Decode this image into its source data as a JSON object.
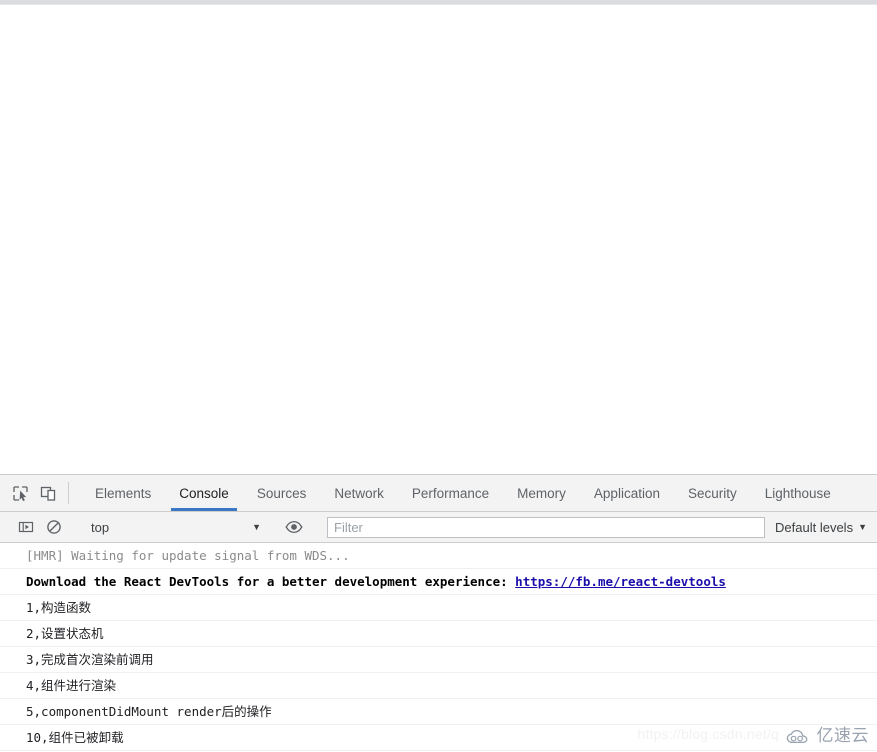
{
  "page": {
    "blank_content": ""
  },
  "devtools": {
    "toolbar_icons": [
      {
        "name": "inspect-element-icon",
        "title": "Inspect element"
      },
      {
        "name": "device-toolbar-icon",
        "title": "Toggle device toolbar"
      }
    ],
    "tabs": [
      {
        "label": "Elements",
        "active": false
      },
      {
        "label": "Console",
        "active": true
      },
      {
        "label": "Sources",
        "active": false
      },
      {
        "label": "Network",
        "active": false
      },
      {
        "label": "Performance",
        "active": false
      },
      {
        "label": "Memory",
        "active": false
      },
      {
        "label": "Application",
        "active": false
      },
      {
        "label": "Security",
        "active": false
      },
      {
        "label": "Lighthouse",
        "active": false
      }
    ],
    "accent_color": "#3b78c3",
    "filterbar": {
      "sidebar_toggle_icon": "console-sidebar-icon",
      "clear_icon": "clear-console-icon",
      "context_value": "top",
      "context_caret": "▼",
      "eye_icon": "live-expression-eye-icon",
      "filter_value": "",
      "filter_placeholder": "Filter",
      "levels_label": "Default levels",
      "levels_caret": "▼"
    },
    "messages": [
      {
        "text": "[HMR] Waiting for update signal from WDS...",
        "style": "dim"
      },
      {
        "text": "Download the React DevTools for a better development experience: ",
        "style": "bold",
        "link": "https://fb.me/react-devtools"
      },
      {
        "text": "1,构造函数",
        "style": "normal"
      },
      {
        "text": "2,设置状态机",
        "style": "normal"
      },
      {
        "text": "3,完成首次渲染前调用",
        "style": "normal"
      },
      {
        "text": "4,组件进行渲染",
        "style": "normal"
      },
      {
        "text": "5,componentDidMount render后的操作",
        "style": "normal"
      },
      {
        "text": "10,组件已被卸载",
        "style": "normal"
      }
    ]
  },
  "watermarks": {
    "csdn": "https://blog.csdn.net/q",
    "brand_text": "亿速云",
    "brand_icon": "cloud-logo-icon"
  }
}
